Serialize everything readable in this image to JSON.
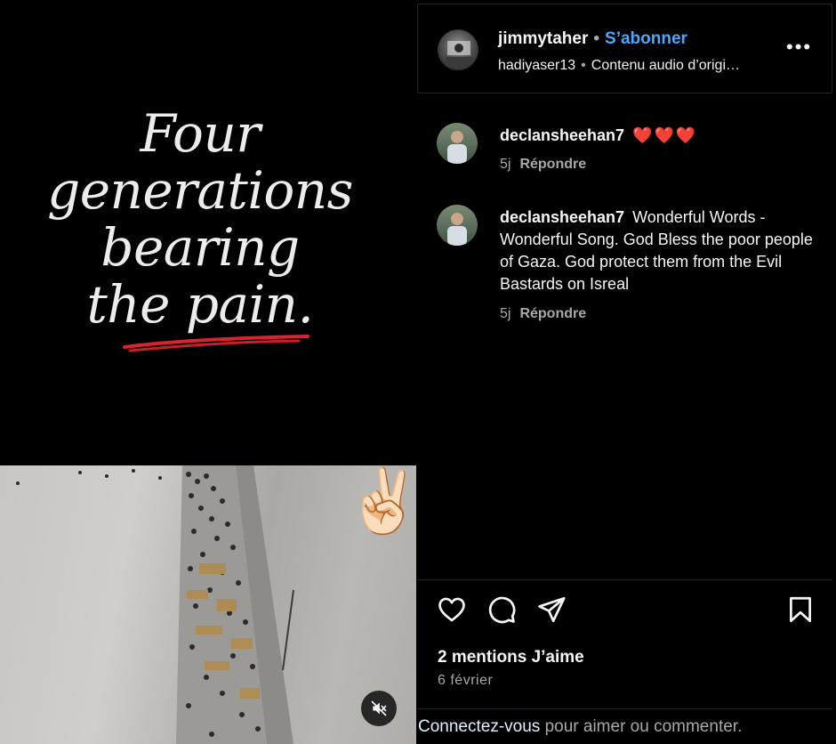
{
  "media": {
    "headline_lines": [
      "Four",
      "generations",
      "bearing",
      "the pain."
    ],
    "emoji": "✌🏻",
    "mute_icon": "speaker-muted-icon"
  },
  "header": {
    "username": "jimmytaher",
    "separator": "•",
    "follow_label": "S’abonner",
    "audio_user": "hadiyaser13",
    "audio_label": "Contenu audio d’origi…",
    "more_label": "•••"
  },
  "comments": [
    {
      "username": "declansheehan7",
      "text": "",
      "hearts": "❤️❤️❤️",
      "age": "5j",
      "reply_label": "Répondre"
    },
    {
      "username": "declansheehan7",
      "text": "Wonderful Words - Wonderful Song. God Bless the poor people of Gaza. God protect them from the Evil Bastards on Isreal",
      "hearts": "",
      "age": "5j",
      "reply_label": "Répondre"
    }
  ],
  "footer": {
    "likes": "2 mentions J’aime",
    "date": "6 février",
    "login_link": "Connectez-vous",
    "login_rest": " pour aimer ou commenter."
  },
  "colors": {
    "background": "#000000",
    "follow": "#4aa8ff",
    "heart": "#ff3040",
    "muted_text": "#a8a8a8",
    "underline": "#d9232e"
  }
}
